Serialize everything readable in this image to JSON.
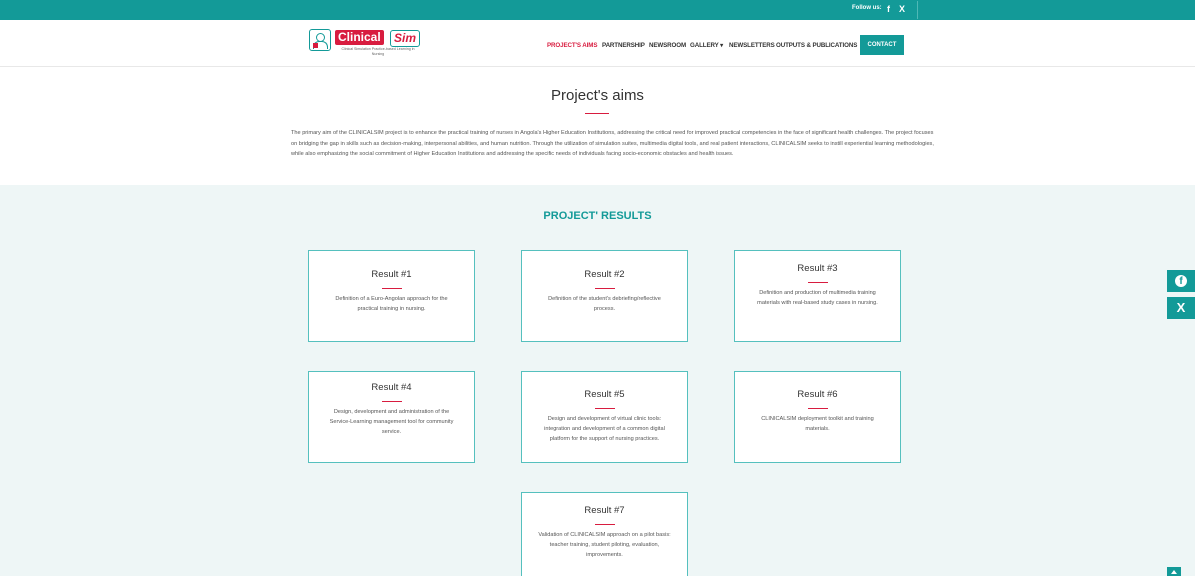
{
  "topbar": {
    "follow_label": "Follow us:",
    "facebook_glyph": "f",
    "x_glyph": "X"
  },
  "logo": {
    "word1": "Clinical",
    "word2": "Sim",
    "tagline": "Clinical Simulation Practice-based Learning in Nursing"
  },
  "nav": {
    "items": [
      "PROJECT'S AIMS",
      "PARTNERSHIP",
      "NEWSROOM",
      "GALLERY ▾",
      "NEWSLETTERS",
      "OUTPUTS & PUBLICATIONS"
    ],
    "active_index": 0,
    "contact": "CONTACT"
  },
  "aims": {
    "title": "Project's aims",
    "text": "The primary aim of the CLINICALSIM project is to enhance the practical training of nurses in Angola's Higher Education Institutions, addressing the critical need for improved practical competencies in the face of significant health challenges. The project focuses on bridging the gap in skills such as decision-making, interpersonal abilities, and human nutrition. Through the utilization of simulation suites, multimedia digital tools, and real patient interactions, CLINICALSIM seeks to instill experiential learning methodologies, while also emphasizing the social commitment of Higher Education Institutions and addressing the specific needs of individuals facing socio-economic obstacles and health issues."
  },
  "results": {
    "title": "PROJECT' RESULTS",
    "cards": [
      {
        "title": "Result #1",
        "desc": "Definition of a Euro-Angolan approach for the practical training in nursing."
      },
      {
        "title": "Result #2",
        "desc": "Definition of the student's debriefing/reflective process."
      },
      {
        "title": "Result #3",
        "desc": "Definition and production of multimedia training materials with real-based study cases in nursing."
      },
      {
        "title": "Result #4",
        "desc": "Design, development and administration of the Service-Learning management tool for community service."
      },
      {
        "title": "Result #5",
        "desc": "Design and development of virtual clinic tools: integration and development of a common digital platform for the support of nursing practices."
      },
      {
        "title": "Result #6",
        "desc": "CLINICALSIM deployment toolkit and training materials."
      },
      {
        "title": "Result #7",
        "desc": "Validation of CLINICALSIM approach on a pilot basis: teacher training, student piloting, evaluation, improvements."
      }
    ]
  },
  "side": {
    "facebook_glyph": "f",
    "x_glyph": "X"
  },
  "colors": {
    "teal": "#139a98",
    "red": "#d81c3f",
    "section_bg": "#eef6f6"
  }
}
